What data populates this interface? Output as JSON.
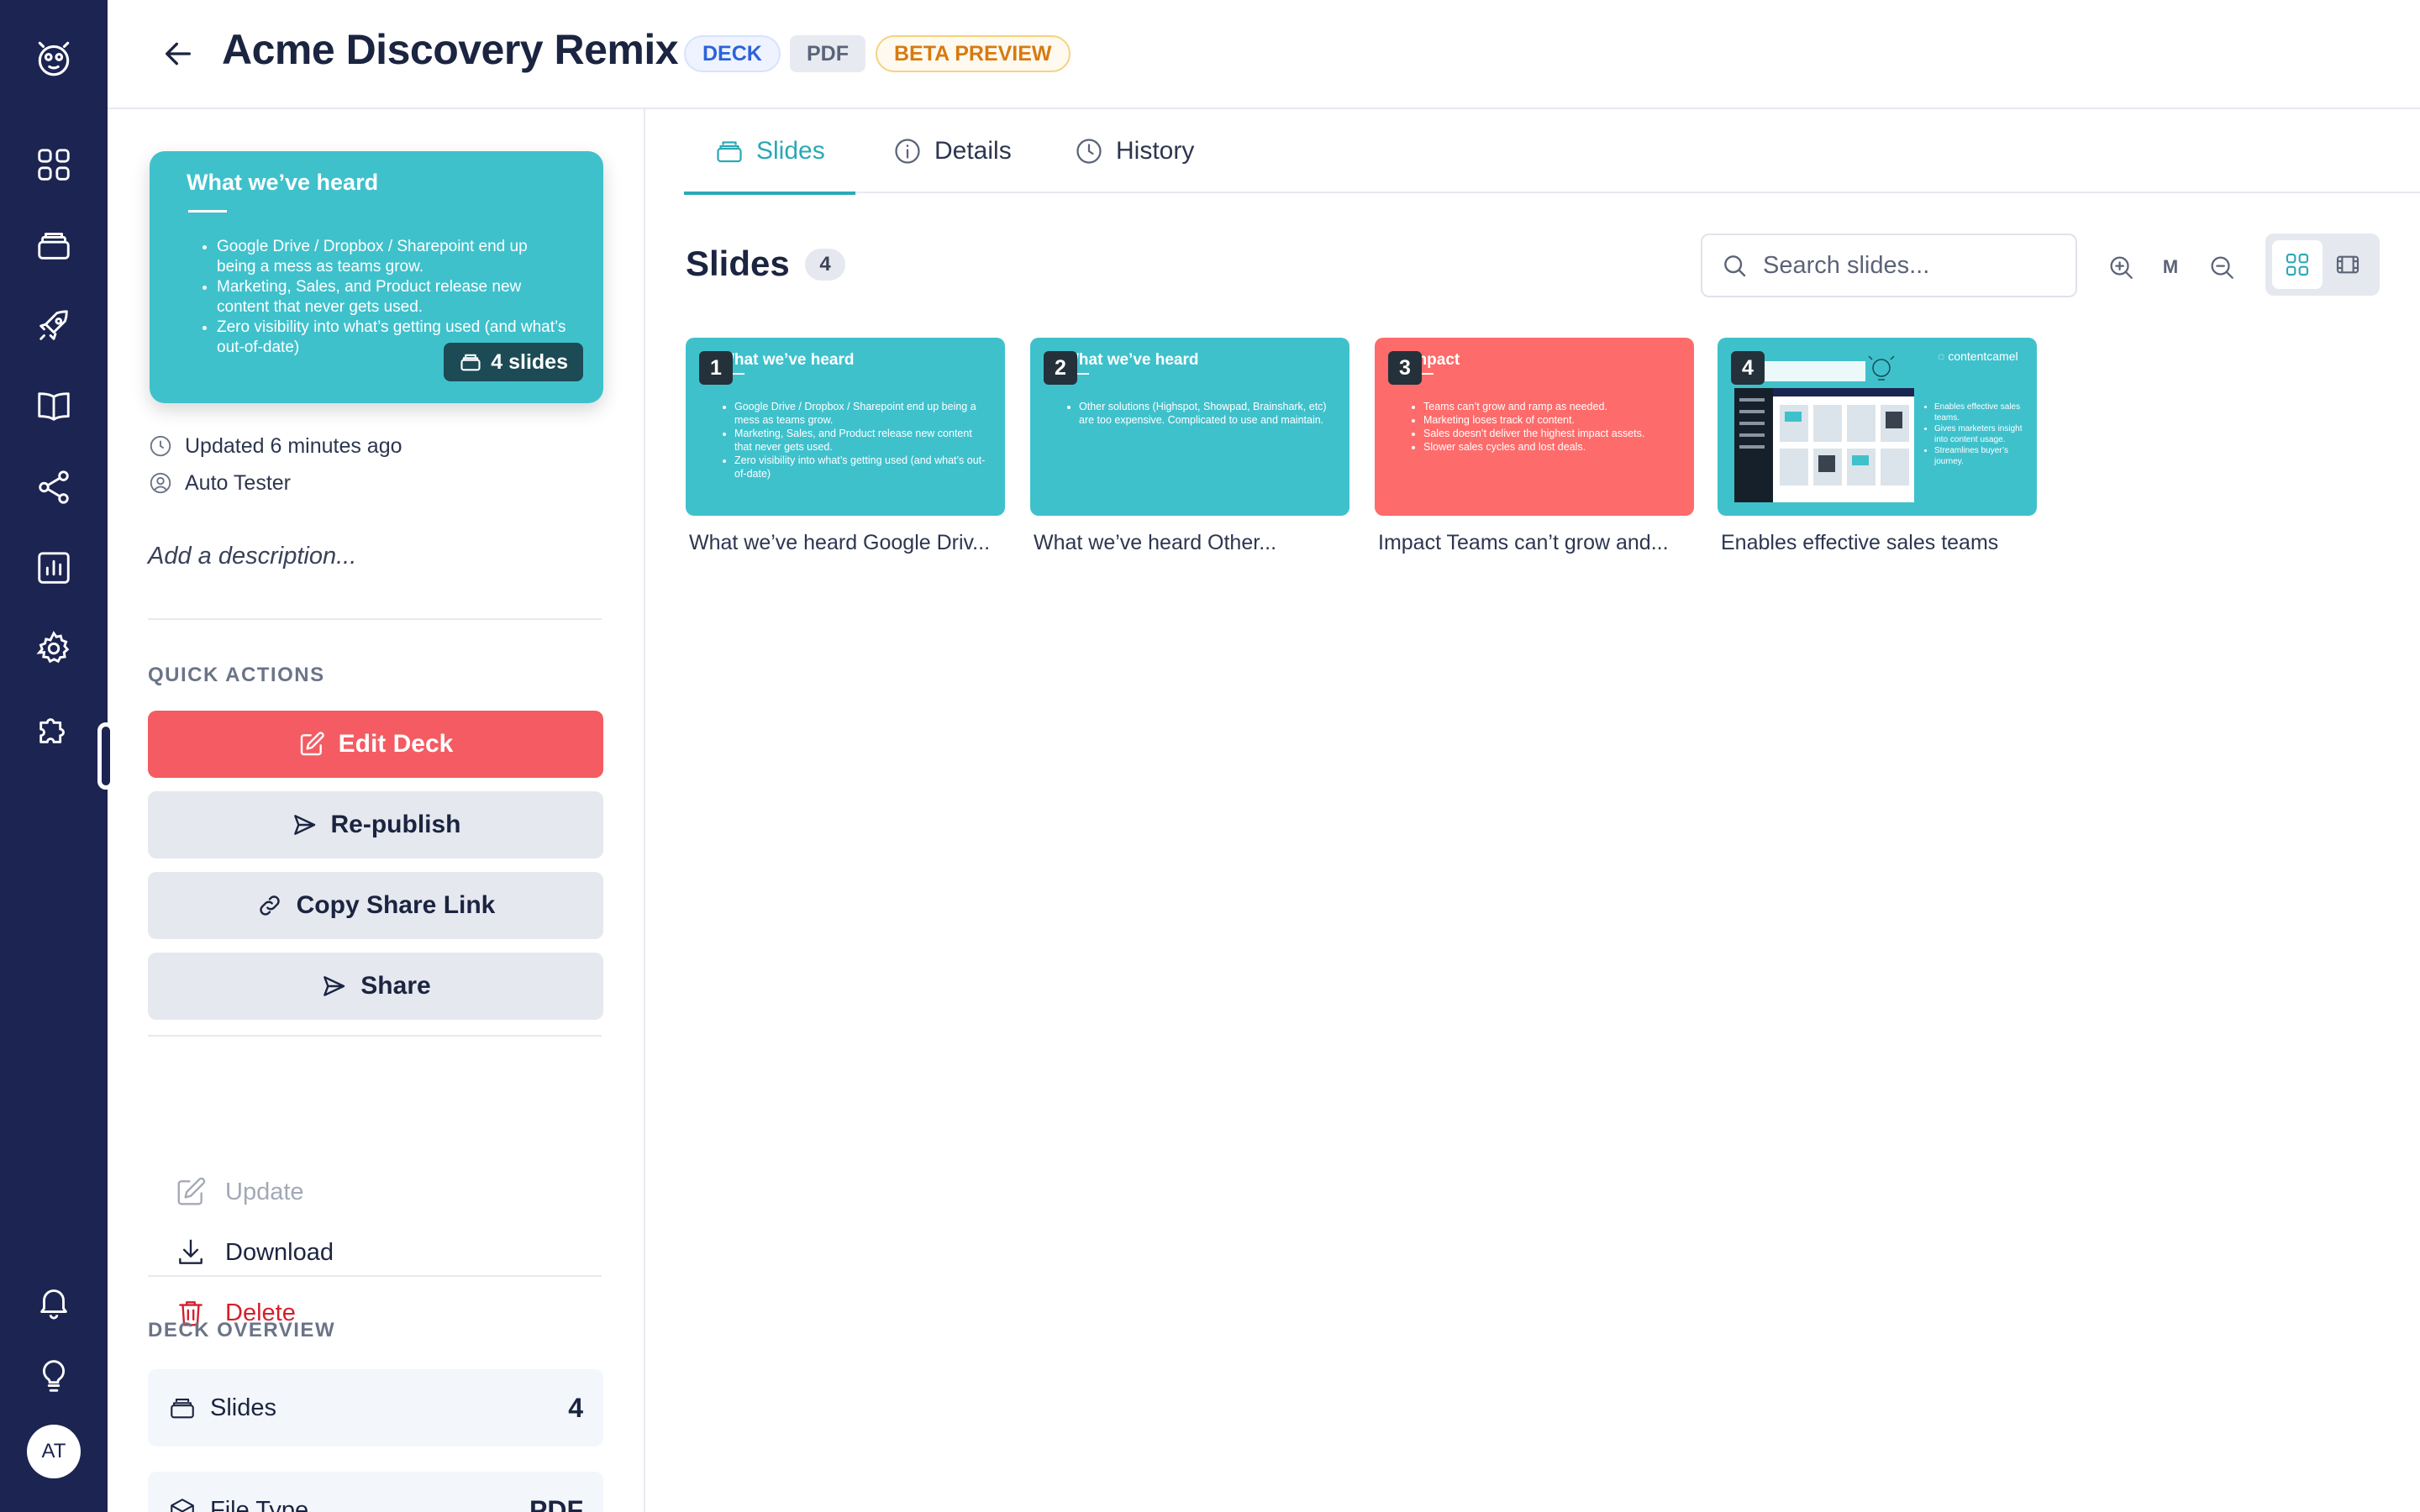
{
  "user": {
    "initials": "AT"
  },
  "header": {
    "title": "Acme Discovery Remix",
    "badges": {
      "deck": "DECK",
      "pdf": "PDF",
      "beta": "BETA PREVIEW"
    }
  },
  "preview": {
    "title": "What we’ve heard",
    "bullets": [
      "Google Drive / Dropbox / Sharepoint end up being a mess as teams grow.",
      "Marketing, Sales, and Product release new content that never gets used.",
      "Zero visibility into what’s getting used (and what’s out-of-date)"
    ],
    "slide_count": "4 slides"
  },
  "meta": {
    "updated": "Updated 6 minutes ago",
    "owner": "Auto Tester"
  },
  "description_placeholder": "Add a description...",
  "quick_actions": {
    "label": "QUICK ACTIONS",
    "edit": "Edit Deck",
    "republish": "Re-publish",
    "copy_link": "Copy Share Link",
    "share": "Share",
    "update": "Update",
    "download": "Download",
    "delete": "Delete"
  },
  "overview": {
    "label": "DECK OVERVIEW",
    "slides_label": "Slides",
    "slides_value": "4",
    "filetype_label": "File Type",
    "filetype_value": "PDF"
  },
  "tabs": {
    "slides": "Slides",
    "details": "Details",
    "history": "History"
  },
  "slides_section": {
    "title": "Slides",
    "count": "4",
    "search_placeholder": "Search slides...",
    "zoom_label": "M"
  },
  "slides": [
    {
      "number": "1",
      "heading": "What we’ve heard",
      "bullets": [
        "Google Drive / Dropbox / Sharepoint end up being a mess as teams grow.",
        "Marketing, Sales, and Product release new content that never gets used.",
        "Zero visibility into what’s getting used (and what’s out-of-date)"
      ],
      "caption": "What we’ve heard Google Driv...",
      "color": "#3fc1cc"
    },
    {
      "number": "2",
      "heading": "What we’ve heard",
      "bullets": [
        "Other solutions (Highspot, Showpad, Brainshark, etc) are too expensive. Complicated to use and maintain."
      ],
      "caption": "What we’ve heard Other...",
      "color": "#3fc1cc"
    },
    {
      "number": "3",
      "heading": "Impact",
      "bullets": [
        "Teams can’t grow and ramp as needed.",
        "Marketing loses track of content.",
        "Sales doesn’t deliver the highest impact assets.",
        "Slower sales cycles and lost deals."
      ],
      "caption": "Impact Teams can’t grow and...",
      "color": "#fe6b6b"
    },
    {
      "number": "4",
      "brand": "contentcamel",
      "bullets": [
        "Enables effective sales teams.",
        "Gives marketers insight into content usage.",
        "Streamlines buyer’s journey."
      ],
      "caption": "Enables effective sales teams",
      "color": "#3fc1cc"
    }
  ],
  "colors": {
    "nav_bg": "#1c2452",
    "accent_teal": "#2aa9b6",
    "primary_button": "#f45b62",
    "danger": "#d51f2c"
  }
}
